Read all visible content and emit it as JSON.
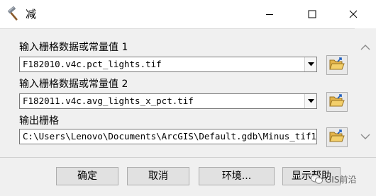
{
  "window": {
    "title": "减",
    "icon": "hammer-icon"
  },
  "fields": {
    "input1": {
      "label": "输入栅格数据或常量值 1",
      "value": "F182010.v4c.pct_lights.tif"
    },
    "input2": {
      "label": "输入栅格数据或常量值 2",
      "value": "F182011.v4c.avg_lights_x_pct.tif"
    },
    "output": {
      "label": "输出栅格",
      "value": "C:\\Users\\Lenovo\\Documents\\ArcGIS\\Default.gdb\\Minus_tif1"
    }
  },
  "buttons": {
    "ok": "确定",
    "cancel": "取消",
    "environments": "环境...",
    "show_help": "显示帮助"
  },
  "watermark": {
    "text": "GIS前沿"
  }
}
